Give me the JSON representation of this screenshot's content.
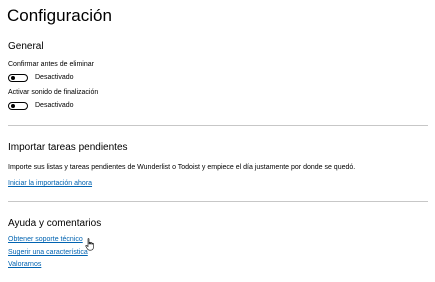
{
  "page": {
    "title": "Configuración"
  },
  "general": {
    "heading": "General",
    "confirm_delete": {
      "label": "Confirmar antes de eliminar",
      "state": "Desactivado",
      "on": false
    },
    "completion_sound": {
      "label": "Activar sonido de finalización",
      "state": "Desactivado",
      "on": false
    }
  },
  "import": {
    "heading": "Importar tareas pendientes",
    "description": "Importe sus listas y tareas pendientes de Wunderlist o Todoist y empiece el día justamente por donde se quedó.",
    "link": "Iniciar la importación ahora"
  },
  "feedback": {
    "heading": "Ayuda y comentarios",
    "support_link": "Obtener soporte técnico",
    "suggest_link": "Sugerir una característica",
    "rate_link": "Valorarnos"
  },
  "colors": {
    "link": "#0063b1",
    "divider": "#c7c7c7",
    "text": "#000000"
  },
  "icons": {
    "cursor": "hand-pointer-icon"
  }
}
